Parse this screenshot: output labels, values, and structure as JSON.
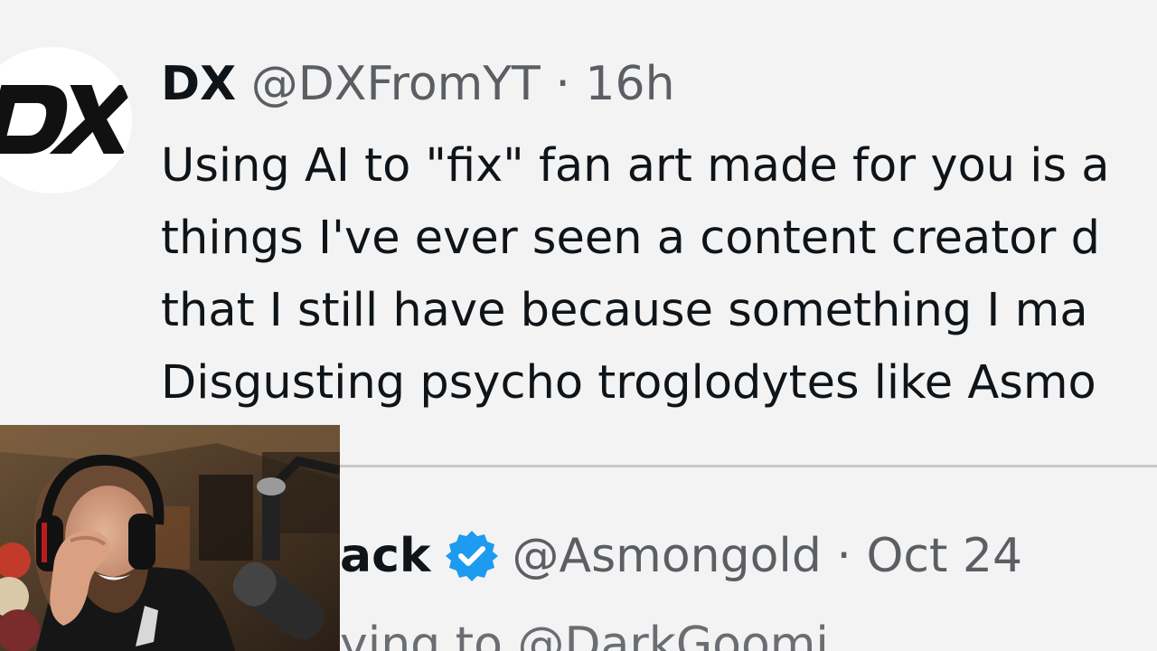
{
  "tweet1": {
    "display_name": "DX",
    "handle": "@DXFromYT",
    "separator": "·",
    "time": "16h",
    "avatar_logo_text": "DX",
    "body_lines": [
      "Using AI to \"fix\" fan art made for you is a",
      "things I've ever seen a content creator d",
      "that I still have because something I ma",
      "Disgusting psycho troglodytes like Asmo"
    ]
  },
  "tweet2": {
    "display_name": "ack",
    "handle": "@Asmongold",
    "separator": "·",
    "date": "Oct 24",
    "reply_text": "ying to @DarkGoomi",
    "verified_icon": "verified-badge-icon",
    "verified_color": "#1d9bf0"
  },
  "webcam": {
    "description_icon": "streamer-webcam"
  }
}
